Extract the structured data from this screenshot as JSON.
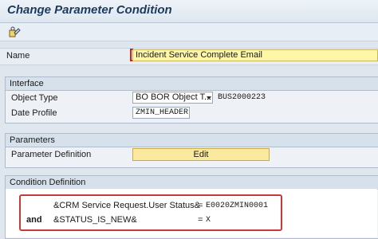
{
  "window": {
    "title": "Change Parameter Condition"
  },
  "toolbar": {
    "icon": "display-change-icon"
  },
  "name_row": {
    "label": "Name",
    "value": "Incident Service Complete Email"
  },
  "interface": {
    "group_title": "Interface",
    "object_type_label": "Object Type",
    "object_type_select": "BO BOR Object T...",
    "object_type_value": "BUS2000223",
    "date_profile_label": "Date Profile",
    "date_profile_value": "ZMIN_HEADER"
  },
  "parameters": {
    "group_title": "Parameters",
    "definition_label": "Parameter Definition",
    "edit_button": "Edit"
  },
  "condition": {
    "group_title": "Condition Definition",
    "lines": [
      {
        "operator": "",
        "field": "&CRM Service Request.User Status&",
        "comparator": "=",
        "value": "E0020ZMIN0001"
      },
      {
        "operator": "and",
        "field": "&STATUS_IS_NEW&",
        "comparator": "=",
        "value": "X"
      }
    ]
  },
  "colors": {
    "required_field": "#fff6a8",
    "highlight_border": "#c63a3a",
    "button": "#fbe9a0"
  }
}
